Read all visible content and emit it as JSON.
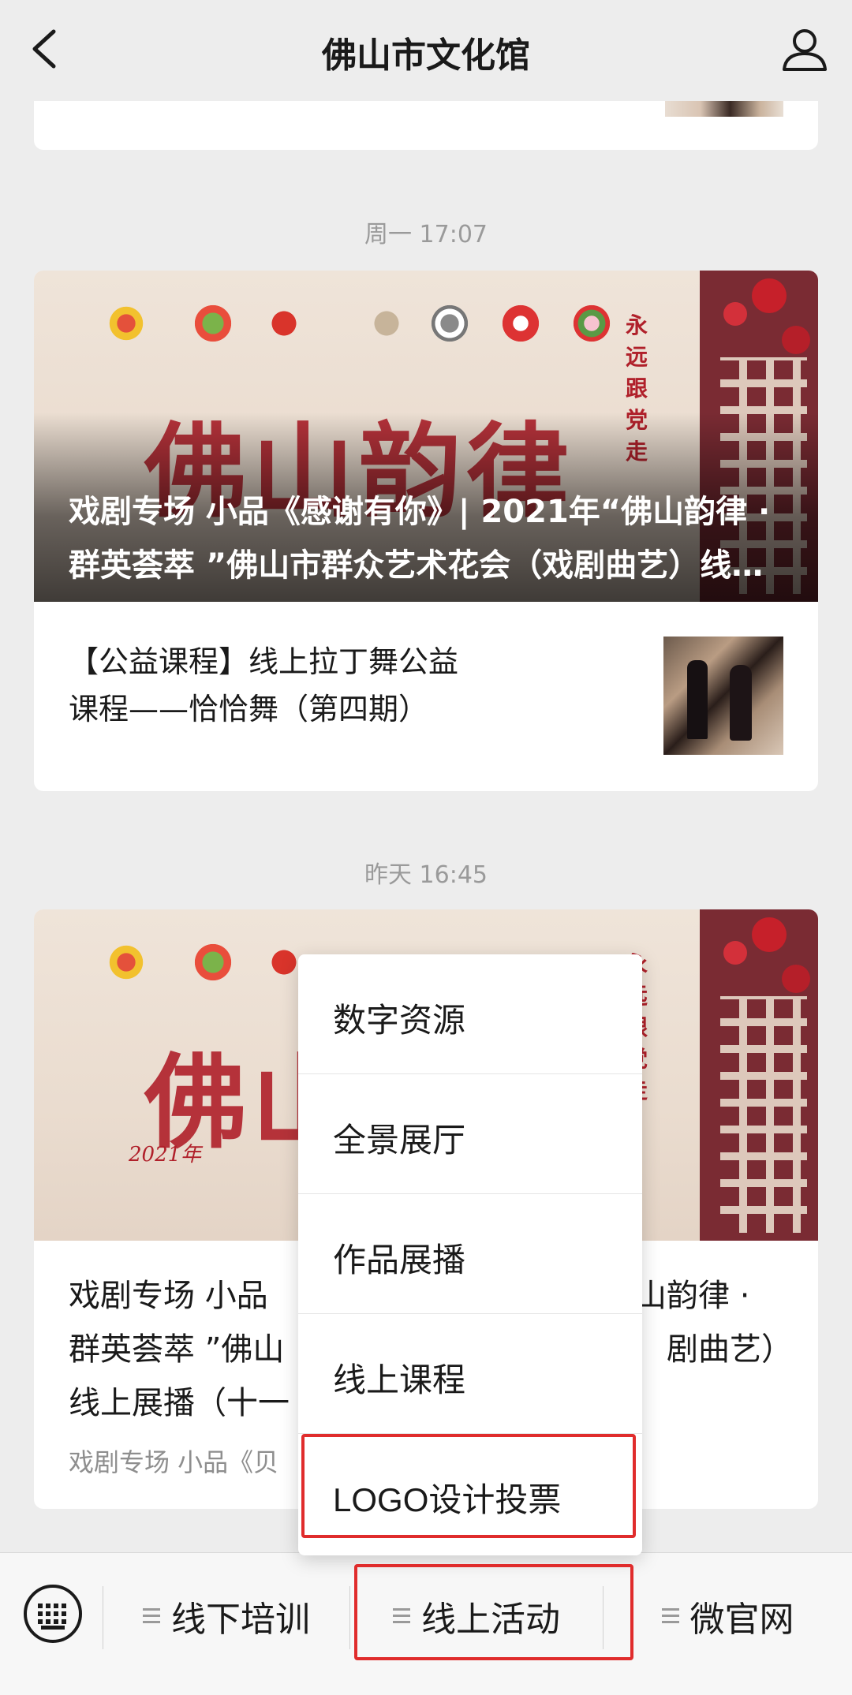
{
  "header": {
    "title": "佛山市文化馆",
    "back_icon": "chevron-left-icon",
    "profile_icon": "person-icon"
  },
  "feed": [
    {
      "timestamp": "周一 17:07",
      "main_title": "戏剧专场 小品《感谢有你》| 2021年“佛山韵律 · 群英荟萃 ”佛山市群众艺术花会（戏剧曲艺）线上展播（十一）",
      "sub_title": "【公益课程】线上拉丁舞公益课程——恰恰舞（第四期）"
    },
    {
      "timestamp": "昨天 16:45",
      "title": "戏剧专场 小品《感谢有你》| 2021年“佛山韵律 · 群英荟萃 ”佛山市群众艺术花会（戏剧曲艺）线上展播（十一）",
      "title_visible_parts": {
        "line1_left": "戏剧专场 小品",
        "line1_right": "山韵律 ·",
        "line2_left": "群英荟萃 ”佛山",
        "line2_right": "剧曲艺）",
        "line3_left": "线上展播（十一"
      },
      "digest": "戏剧专场 小品《贝"
    }
  ],
  "popup_menu": {
    "items": [
      "数字资源",
      "全景展厅",
      "作品展播",
      "线上课程",
      "LOGO设计投票"
    ],
    "highlighted_item": "LOGO设计投票"
  },
  "bottom_bar": {
    "keyboard_icon": "keyboard-icon",
    "tabs": [
      "线下培训",
      "线上活动",
      "微官网"
    ],
    "active_tab": "线上活动"
  },
  "colors": {
    "background": "#ededed",
    "highlight_box": "#e02c2c",
    "poster_red": "#b0202a",
    "lattice": "#7a2b33"
  },
  "poster_text": {
    "calligraphy": "佛山韵律",
    "year": "2021年",
    "slogan": "永远跟党走"
  }
}
